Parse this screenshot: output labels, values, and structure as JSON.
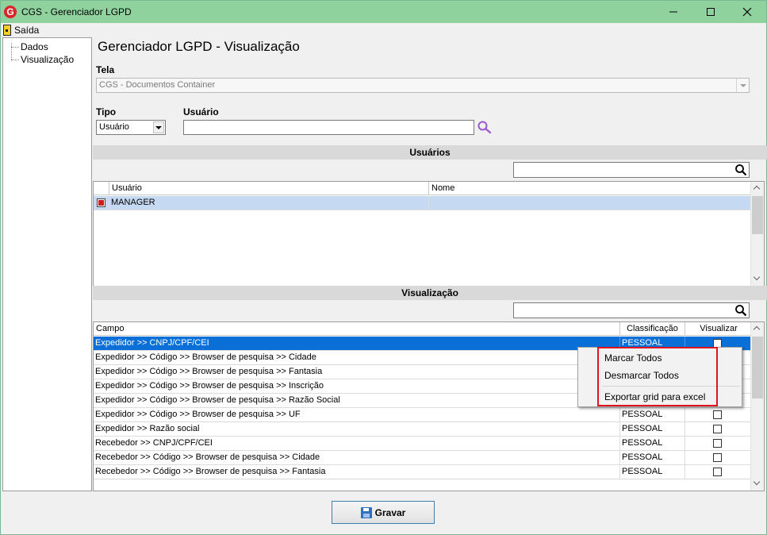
{
  "window": {
    "title": "CGS - Gerenciador LGPD",
    "minimize_glyph": "—",
    "maximize_glyph": "☐",
    "close_glyph": "✕"
  },
  "menu": {
    "exit_label": "Saída"
  },
  "tree": {
    "items": [
      "Dados",
      "Visualização"
    ]
  },
  "page": {
    "title": "Gerenciador LGPD - Visualização",
    "tela_label": "Tela",
    "tela_value": "CGS - Documentos Container",
    "tipo_label": "Tipo",
    "tipo_value": "Usuário",
    "usuario_label": "Usuário",
    "usuario_value": ""
  },
  "usuarios": {
    "section_title": "Usuários",
    "filter_value": "",
    "columns": [
      "Usuário",
      "Nome"
    ],
    "rows": [
      {
        "usuario": "MANAGER",
        "nome": "",
        "checked": true
      }
    ]
  },
  "visualizacao": {
    "section_title": "Visualização",
    "filter_value": "",
    "columns": [
      "Campo",
      "Classificação",
      "Visualizar"
    ],
    "rows": [
      {
        "campo": "Expedidor >> CNPJ/CPF/CEI",
        "classificacao": "PESSOAL"
      },
      {
        "campo": "Expedidor >> Código >> Browser de pesquisa >> Cidade",
        "classificacao": ""
      },
      {
        "campo": "Expedidor >> Código >> Browser de pesquisa >> Fantasia",
        "classificacao": ""
      },
      {
        "campo": "Expedidor >> Código >> Browser de pesquisa >> Inscrição",
        "classificacao": ""
      },
      {
        "campo": "Expedidor >> Código >> Browser de pesquisa >> Razão Social",
        "classificacao": ""
      },
      {
        "campo": "Expedidor >> Código >> Browser de pesquisa >> UF",
        "classificacao": "PESSOAL"
      },
      {
        "campo": "Expedidor >> Razão social",
        "classificacao": "PESSOAL"
      },
      {
        "campo": "Recebedor >> CNPJ/CPF/CEI",
        "classificacao": "PESSOAL"
      },
      {
        "campo": "Recebedor >> Código >> Browser de pesquisa >> Cidade",
        "classificacao": "PESSOAL"
      },
      {
        "campo": "Recebedor >> Código >> Browser de pesquisa >> Fantasia",
        "classificacao": "PESSOAL"
      }
    ]
  },
  "context_menu": {
    "items": [
      "Marcar Todos",
      "Desmarcar Todos",
      "Exportar grid para excel"
    ]
  },
  "footer": {
    "save_label": "Gravar"
  },
  "colors": {
    "titlebar": "#8fd29d",
    "selection": "#0a6fd6",
    "highlight": "#e0141e"
  }
}
